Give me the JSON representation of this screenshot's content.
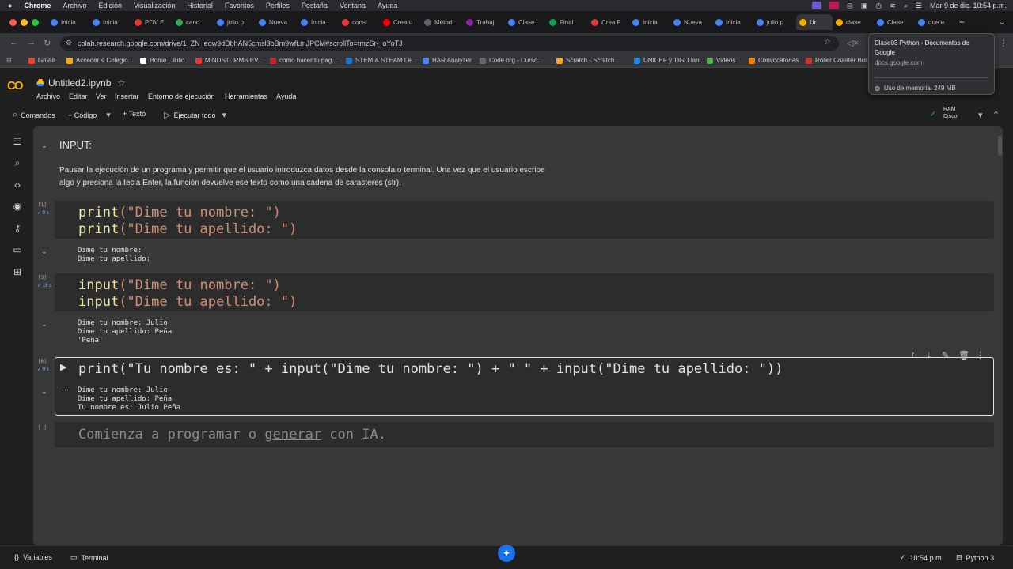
{
  "mac_menu": {
    "apple": "",
    "app": "Chrome",
    "items": [
      "Archivo",
      "Edición",
      "Visualización",
      "Historial",
      "Favoritos",
      "Perfiles",
      "Pestaña",
      "Ventana",
      "Ayuda"
    ],
    "clock": "Mar 9 de dic.  10:54 p.m."
  },
  "tabs": [
    {
      "label": "Inicia"
    },
    {
      "label": "Inicia"
    },
    {
      "label": "POV E"
    },
    {
      "label": "cand"
    },
    {
      "label": "julio p"
    },
    {
      "label": "Nueva"
    },
    {
      "label": "Inicia"
    },
    {
      "label": "consi"
    },
    {
      "label": "Crea u"
    },
    {
      "label": "Métod"
    },
    {
      "label": "Trabaj"
    },
    {
      "label": "Clase"
    },
    {
      "label": "Final"
    },
    {
      "label": "Crea F"
    },
    {
      "label": "Inicia"
    },
    {
      "label": "Nueva"
    },
    {
      "label": "Inicia"
    },
    {
      "label": "julio p"
    },
    {
      "label": "Ur"
    },
    {
      "label": "clase"
    },
    {
      "label": "Clase"
    },
    {
      "label": "que e"
    }
  ],
  "address": {
    "url": "colab.research.google.com/drive/1_ZN_edw9dDbhAN5cmsl3bBm9wfLmJPCM#scrollTo=tmzSr-_oYoTJ"
  },
  "bookmarks": [
    {
      "label": "Gmail",
      "color": "#ea4335"
    },
    {
      "label": "Acceder < Colegio...",
      "color": "#f9ab00"
    },
    {
      "label": "Home | Julio",
      "color": "#ffffff"
    },
    {
      "label": "MINDSTORMS EV...",
      "color": "#e53935"
    },
    {
      "label": "como hacer tu pag...",
      "color": "#c62828"
    },
    {
      "label": "STEM & STEAM Le...",
      "color": "#1976d2"
    },
    {
      "label": "HAR Analyzer",
      "color": "#4285f4"
    },
    {
      "label": "Code.org - Curso...",
      "color": "#666666"
    },
    {
      "label": "Scratch - Scratch...",
      "color": "#f9a825"
    },
    {
      "label": "UNICEF y TIGO lan...",
      "color": "#1e88e5"
    },
    {
      "label": "Videos",
      "color": "#4caf50"
    },
    {
      "label": "Convocatorias",
      "color": "#f57c00"
    },
    {
      "label": "Roller Coaster Buil",
      "color": "#d32f2f"
    }
  ],
  "tooltip": {
    "title": "Clase03 Python - Documentos de Google",
    "domain": "docs.google.com",
    "memory": "Uso de memoria: 249 MB"
  },
  "colab": {
    "logo": "CO",
    "title": "Untitled2.ipynb",
    "menus": [
      "Archivo",
      "Editar",
      "Ver",
      "Insertar",
      "Entorno de ejecución",
      "Herramientas",
      "Ayuda"
    ],
    "toolbar": {
      "commands": "Comandos",
      "code": "+ Código",
      "text": "+ Texto",
      "run_all": "Ejecutar todo"
    },
    "ram": "RAM",
    "disk": "Disco"
  },
  "notebook": {
    "heading": "INPUT:",
    "paragraph_1": "Pausar la ejecución de un programa y permitir que el usuario introduzca datos desde la consola o terminal. Una vez que el usuario escribe",
    "paragraph_2": "algo y presiona la tecla Enter, la función devuelve ese texto como una cadena de caracteres (str).",
    "cells": [
      {
        "exec": "[1]",
        "time": "0 s",
        "lines": [
          [
            "print",
            "(\"Dime tu nombre: \")"
          ],
          [
            "print",
            "(\"Dime tu apellido: \")"
          ]
        ],
        "output": "Dime tu nombre:\nDime tu apellido:"
      },
      {
        "exec": "[3]",
        "time": "15 s",
        "lines": [
          [
            "input",
            "(\"Dime tu nombre: \")"
          ],
          [
            "input",
            "(\"Dime tu apellido: \")"
          ]
        ],
        "output": "Dime tu nombre: Julio\nDime tu apellido: Peña\n'Peña'"
      },
      {
        "exec": "[6]",
        "time": "9 s",
        "code": "print(\"Tu nombre es: \" + input(\"Dime tu nombre: \") + \" \" + input(\"Dime tu apellido: \"))",
        "output": "Dime tu nombre: Julio\nDime tu apellido: Peña\nTu nombre es: Julio Peña"
      }
    ],
    "empty_cell": {
      "exec": "[ ]",
      "placeholder_a": "Comienza a programar o ",
      "placeholder_link": "generar",
      "placeholder_b": " con IA."
    }
  },
  "status": {
    "variables": "Variables",
    "terminal": "Terminal",
    "time": "10:54 p.m.",
    "runtime": "Python 3"
  }
}
